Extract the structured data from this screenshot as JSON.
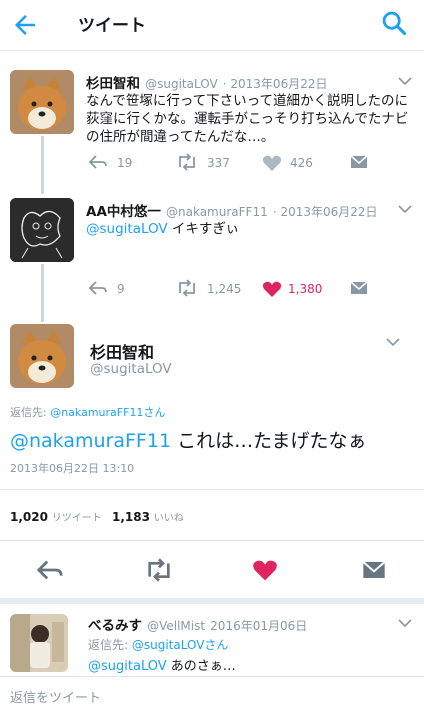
{
  "header": {
    "title": "ツイート"
  },
  "tweet1": {
    "name": "杉田智和",
    "handle": "@sugitaLOV",
    "date": "· 2013年06月22日",
    "text_lines": [
      "なんで笹塚に行って下さいって道細かく説明したのに荻窪に行くかな。運転手がこっそり打ち込んでたナビの住所が間違ってたんだな…。"
    ],
    "replies": "19",
    "retweets": "337",
    "likes": "426"
  },
  "tweet2": {
    "name": "AA中村悠一",
    "handle": "@nakamuraFF11",
    "date": "· 2013年06月22日",
    "mention": "@sugitaLOV",
    "text": " イキすぎぃ",
    "replies": "9",
    "retweets": "1,245",
    "likes": "1,380",
    "like_color": "#e0245e"
  },
  "main_tweet": {
    "name": "杉田智和",
    "handle": "@sugitaLOV",
    "reply_to_label": "返信先: ",
    "reply_to_handle": "@nakamuraFF11さん",
    "mention": "@nakamuraFF11",
    "text": " これは…たまげたなぁ",
    "timestamp": "2013年06月22日 13:10",
    "retweet_count": "1,020",
    "retweet_label": "リツイート",
    "like_count": "1,183",
    "like_label": "いいね"
  },
  "tweet3": {
    "name": "べるみす",
    "handle": "@VellMist",
    "date": "2016年01月06日",
    "reply_to_label": "返信先: ",
    "reply_to_handle": "@sugitaLOVさん",
    "mention": "@sugitaLOV",
    "text": " あのさぁ…"
  },
  "reply_bar": {
    "placeholder": "返信をツイート"
  },
  "colors": {
    "accent": "#1da1f2",
    "gray": "#8899a6",
    "like": "#e0245e"
  }
}
